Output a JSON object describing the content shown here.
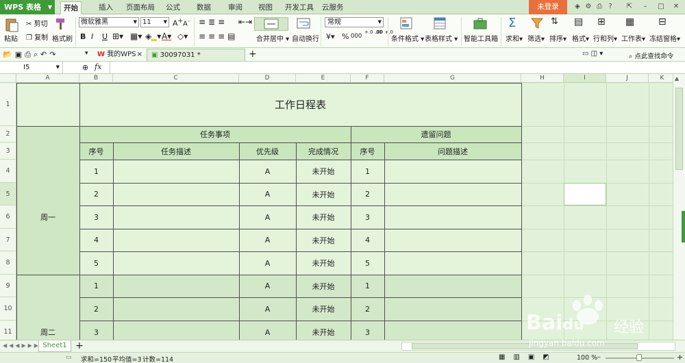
{
  "app": {
    "logo": "WPS 表格",
    "menu_tabs": [
      "开始",
      "插入",
      "页面布局",
      "公式",
      "数据",
      "审阅",
      "视图",
      "开发工具",
      "云服务"
    ],
    "login": "未登录"
  },
  "ribbon": {
    "paste": "粘贴",
    "cut": "剪切",
    "copy": "复制",
    "format_painter": "格式刷",
    "font_name": "微软雅黑",
    "font_size": "11",
    "bold": "B",
    "italic": "I",
    "underline": "U",
    "merge_center": "合并居中",
    "auto_wrap": "自动换行",
    "number_format": "常规",
    "cond_format": "条件格式",
    "table_style": "表格样式",
    "smart_toolbox": "智能工具箱",
    "sum": "求和",
    "filter": "筛选",
    "sort": "排序",
    "format": "格式",
    "row_col": "行和列",
    "worksheet": "工作表",
    "freeze": "冻结窗格",
    "percent": "%",
    "thousands": "000",
    "dec_inc": "+.0 .00",
    "dec_dec": ".00 +.0",
    "find_cmd": "点此查找命令"
  },
  "tabs": {
    "home_tab": "我的WPS",
    "doc_tab": "30097031 *"
  },
  "formula": {
    "cell_ref": "I5",
    "fx": "fx"
  },
  "columns": [
    "A",
    "B",
    "C",
    "D",
    "E",
    "F",
    "G",
    "H",
    "I",
    "J",
    "K"
  ],
  "rows": [
    "1",
    "2",
    "3",
    "4",
    "5",
    "6",
    "7",
    "8",
    "9",
    "10",
    "11"
  ],
  "table": {
    "title": "工作日程表",
    "group_tasks": "任务事项",
    "group_issues": "遗留问题",
    "h_seq": "序号",
    "h_task_desc": "任务描述",
    "h_priority": "优先级",
    "h_status": "完成情况",
    "h_seq2": "序号",
    "h_issue_desc": "问题描述",
    "days": [
      "周一",
      "周二"
    ],
    "rows": [
      {
        "seq": "1",
        "priority": "A",
        "status": "未开始",
        "seq2": "1"
      },
      {
        "seq": "2",
        "priority": "A",
        "status": "未开始",
        "seq2": "2"
      },
      {
        "seq": "3",
        "priority": "A",
        "status": "未开始",
        "seq2": "3"
      },
      {
        "seq": "4",
        "priority": "A",
        "status": "未开始",
        "seq2": "4"
      },
      {
        "seq": "5",
        "priority": "A",
        "status": "未开始",
        "seq2": "5"
      },
      {
        "seq": "1",
        "priority": "A",
        "status": "未开始",
        "seq2": "1"
      },
      {
        "seq": "2",
        "priority": "A",
        "status": "未开始",
        "seq2": "2"
      },
      {
        "seq": "3",
        "priority": "A",
        "status": "未开始",
        "seq2": "3"
      }
    ]
  },
  "sheets": [
    "Sheet1"
  ],
  "status": {
    "sum": "求和=150",
    "avg": "平均值=3",
    "count": "计数=114",
    "zoom": "100 %"
  },
  "watermark": {
    "brand": "Bai",
    "brand2": "经验",
    "url": "jingyan.baidu.com"
  },
  "colors": {
    "accent": "#3f9a38",
    "login": "#e9703c",
    "sheet_bg": "#e2f1d9",
    "header_row": "#c9e6bd"
  }
}
